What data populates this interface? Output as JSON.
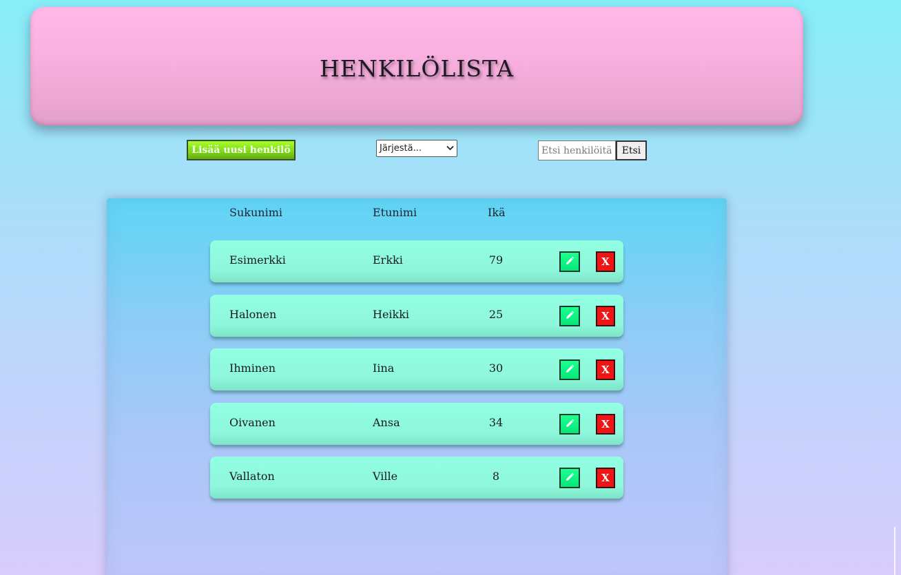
{
  "header": {
    "title": "HENKILÖLISTA"
  },
  "toolbar": {
    "add_label": "Lisää uusi henkilö",
    "sort_selected": "Järjestä...",
    "search_placeholder": "Etsi henkilöitä",
    "search_button_label": "Etsi"
  },
  "table": {
    "columns": [
      "Sukunimi",
      "Etunimi",
      "Ikä"
    ],
    "rows": [
      {
        "surname": "Esimerkki",
        "firstname": "Erkki",
        "age": "79",
        "delete_label": "X"
      },
      {
        "surname": "Halonen",
        "firstname": "Heikki",
        "age": "25",
        "delete_label": "X"
      },
      {
        "surname": "Ihminen",
        "firstname": "Iina",
        "age": "30",
        "delete_label": "X"
      },
      {
        "surname": "Oivanen",
        "firstname": "Ansa",
        "age": "34",
        "delete_label": "X"
      },
      {
        "surname": "Vallaton",
        "firstname": "Ville",
        "age": "8",
        "delete_label": "X"
      }
    ]
  },
  "icons": {
    "edit": "pencil-icon",
    "sort_dropdown": "chevron-down-icon"
  },
  "colors": {
    "header_pink": "#ffb8e8",
    "add_button_green": "#84d81a",
    "row_mint": "#92ffe2",
    "edit_button_green": "#06e77a",
    "delete_button_red": "#f01414"
  }
}
